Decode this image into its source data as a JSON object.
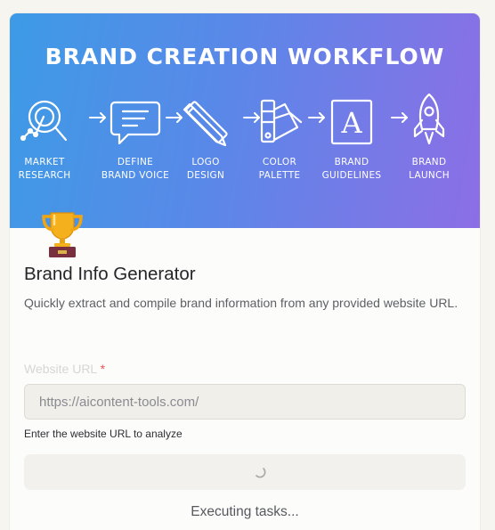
{
  "banner": {
    "title": "BRAND CREATION WORKFLOW",
    "steps": [
      {
        "label": "MARKET\nRESEARCH",
        "icon": "magnifier-chart-icon"
      },
      {
        "label": "DEFINE\nBRAND VOICE",
        "icon": "speech-bubble-icon"
      },
      {
        "label": "LOGO\nDESIGN",
        "icon": "pencil-ruler-icon"
      },
      {
        "label": "COLOR\nPALETTE",
        "icon": "swatch-icon"
      },
      {
        "label": "BRAND\nGUIDELINES",
        "icon": "letter-a-book-icon"
      },
      {
        "label": "BRAND\nLAUNCH",
        "icon": "rocket-icon"
      }
    ]
  },
  "app": {
    "icon": "trophy-icon",
    "title": "Brand Info Generator",
    "description": "Quickly extract and compile brand information from any provided website URL."
  },
  "form": {
    "url_label": "Website URL",
    "required_mark": "*",
    "url_value": "https://aicontent-tools.com/",
    "help_text": "Enter the website URL to analyze"
  },
  "status": {
    "text": "Executing tasks..."
  }
}
